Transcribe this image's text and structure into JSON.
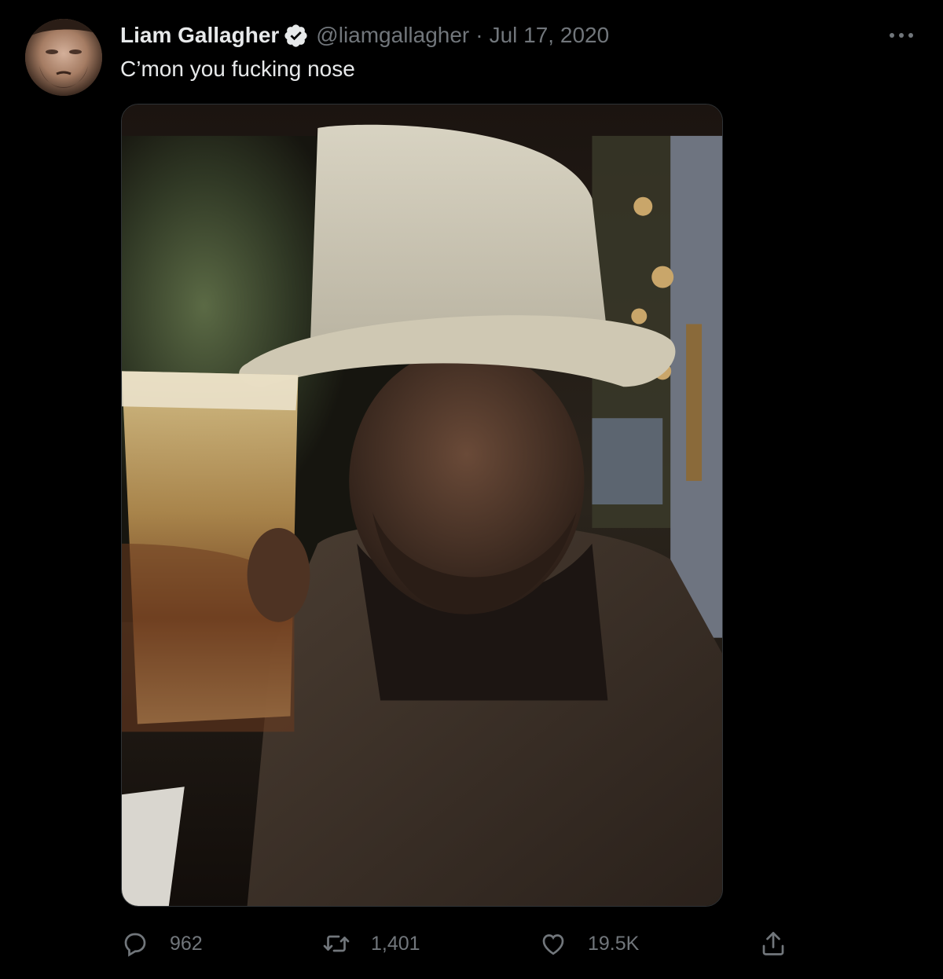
{
  "tweet": {
    "display_name": "Liam Gallagher",
    "handle": "@liamgallagher",
    "separator": "·",
    "date": "Jul 17, 2020",
    "text": "C’mon you fucking nose",
    "verified": true,
    "more_icon": "more-horizontal-icon"
  },
  "metrics": {
    "replies": "962",
    "retweets": "1,401",
    "likes": "19.5K"
  },
  "icons": {
    "reply": "reply-icon",
    "retweet": "retweet-icon",
    "like": "heart-icon",
    "share": "share-icon",
    "verified": "verified-badge-icon"
  },
  "colors": {
    "background": "#000000",
    "primary_text": "#e7e9ea",
    "secondary_text": "#71767b",
    "border": "#2f3336"
  }
}
